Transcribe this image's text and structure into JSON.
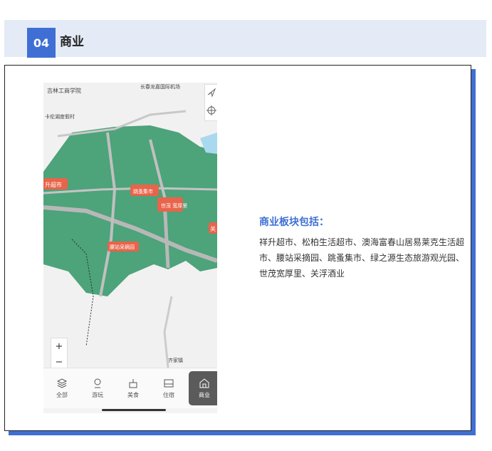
{
  "section": {
    "number": "04",
    "title": "商业"
  },
  "colors": {
    "accent": "#3f6fd4",
    "header_bg": "#e4ebf7",
    "map_green": "#4da37a",
    "marker": "#e8644a"
  },
  "map": {
    "labels": {
      "college": "吉林工商学院",
      "airport": "长春龙嘉国际机场",
      "resort": "卡伦湖度假村",
      "supermarket": "升超市",
      "market": "跳蚤集市",
      "shimao": "世茂\n宽厚里",
      "guanfu": "关",
      "orchard": "腰站采摘园",
      "town": "齐家镇"
    },
    "zoom_in": "+",
    "zoom_out": "−"
  },
  "tabs": [
    {
      "label": "全部",
      "icon": "layers-icon"
    },
    {
      "label": "游玩",
      "icon": "map-pin-icon"
    },
    {
      "label": "美食",
      "icon": "food-icon"
    },
    {
      "label": "住宿",
      "icon": "bed-icon"
    },
    {
      "label": "商业",
      "icon": "shop-icon",
      "active": true
    }
  ],
  "description": {
    "heading": "商业板块包括：",
    "body": "祥升超市、松柏生活超市、澳海富春山居易莱克生活超市、腰站采摘园、跳蚤集市、绿之源生态旅游观光园、世茂宽厚里、关浮酒业"
  }
}
